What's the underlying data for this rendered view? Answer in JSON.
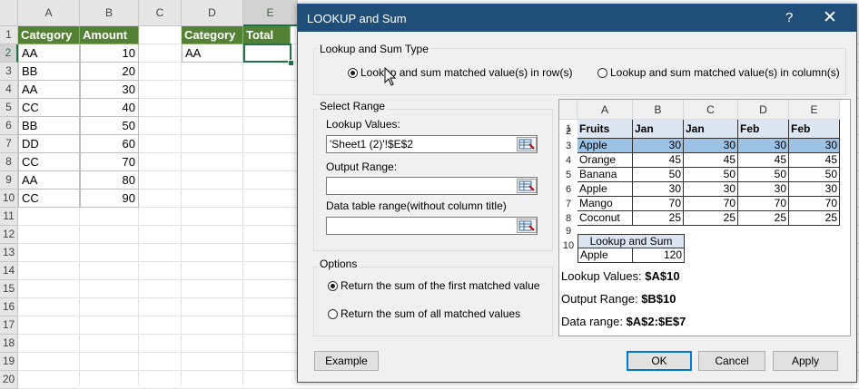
{
  "sheet": {
    "columns": [
      "A",
      "B",
      "C",
      "D",
      "E"
    ],
    "rows": [
      "1",
      "2",
      "3",
      "4",
      "5",
      "6",
      "7",
      "8",
      "9",
      "10",
      "11",
      "12",
      "13",
      "14",
      "15",
      "16",
      "17",
      "18",
      "19",
      "20"
    ],
    "table1": {
      "headers": [
        "Category",
        "Amount"
      ],
      "rows": [
        [
          "AA",
          "10"
        ],
        [
          "BB",
          "20"
        ],
        [
          "AA",
          "30"
        ],
        [
          "CC",
          "40"
        ],
        [
          "BB",
          "50"
        ],
        [
          "DD",
          "60"
        ],
        [
          "CC",
          "70"
        ],
        [
          "AA",
          "80"
        ],
        [
          "CC",
          "90"
        ]
      ]
    },
    "table2": {
      "headers": [
        "Category",
        "Total"
      ],
      "row": [
        "AA",
        ""
      ]
    }
  },
  "dialog": {
    "title": "LOOKUP and Sum",
    "help": "?",
    "close": "✕",
    "type_group": {
      "label": "Lookup and Sum Type",
      "options": [
        "Lookup and sum matched value(s) in row(s)",
        "Lookup and sum matched value(s) in column(s)"
      ],
      "selected": 0
    },
    "range_group": {
      "label": "Select Range",
      "lookup_label": "Lookup Values:",
      "lookup_value": "'Sheet1 (2)'!$E$2",
      "output_label": "Output Range:",
      "output_value": "",
      "table_label": "Data table range(without column title)",
      "table_value": ""
    },
    "options_group": {
      "label": "Options",
      "options": [
        "Return the sum of the first matched value",
        "Return the sum of all matched values"
      ],
      "selected": 0
    },
    "buttons": {
      "example": "Example",
      "ok": "OK",
      "cancel": "Cancel",
      "apply": "Apply"
    },
    "preview": {
      "cols": [
        "A",
        "B",
        "C",
        "D",
        "E"
      ],
      "rows": [
        "1",
        "2",
        "3",
        "4",
        "5",
        "6",
        "7",
        "8",
        "9",
        "10"
      ],
      "headers": [
        "Fruits",
        "Jan",
        "Jan",
        "Feb",
        "Feb"
      ],
      "data": [
        [
          "Apple",
          "30",
          "30",
          "30",
          "30"
        ],
        [
          "Orange",
          "45",
          "45",
          "45",
          "45"
        ],
        [
          "Banana",
          "50",
          "50",
          "50",
          "50"
        ],
        [
          "Apple",
          "30",
          "30",
          "30",
          "30"
        ],
        [
          "Mango",
          "70",
          "70",
          "70",
          "70"
        ],
        [
          "Coconut",
          "25",
          "25",
          "25",
          "25"
        ]
      ],
      "result_title": "Lookup and Sum",
      "result": [
        "Apple",
        "120"
      ],
      "notes": [
        {
          "label": "Lookup Values:",
          "value": "$A$10"
        },
        {
          "label": "Output Range:",
          "value": "$B$10"
        },
        {
          "label": "Data range:",
          "value": "$A$2:$E$7"
        }
      ]
    }
  }
}
